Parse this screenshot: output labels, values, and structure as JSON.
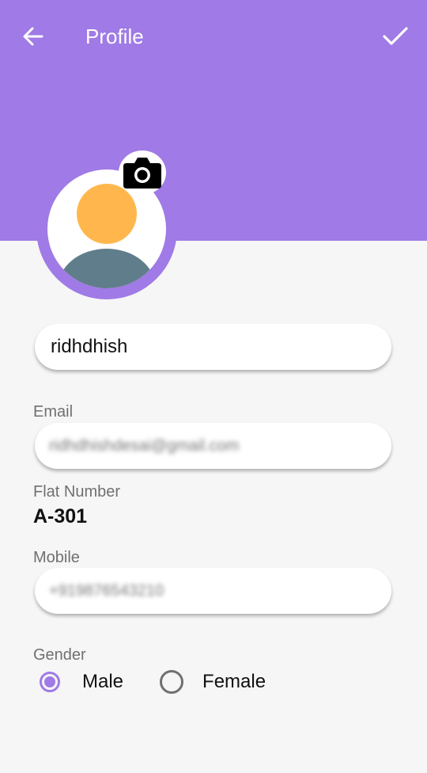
{
  "app_bar": {
    "title": "Profile",
    "back_icon": "arrow-back-icon",
    "save_icon": "check-icon"
  },
  "avatar": {
    "placeholder_icon": "person-avatar-icon",
    "edit_icon": "camera-icon"
  },
  "form": {
    "name": {
      "value": "ridhdhish"
    },
    "email": {
      "label": "Email",
      "value": "ridhdhishdesai@gmail.com"
    },
    "flat": {
      "label": "Flat Number",
      "value": "A-301"
    },
    "mobile": {
      "label": "Mobile",
      "value": "+919876543210"
    },
    "gender": {
      "label": "Gender",
      "options": [
        {
          "label": "Male",
          "selected": true
        },
        {
          "label": "Female",
          "selected": false
        }
      ]
    }
  },
  "colors": {
    "accent": "#a07ae6",
    "background": "#f6f6f6",
    "avatar_head": "#ffb74d",
    "avatar_body": "#607d8b"
  }
}
